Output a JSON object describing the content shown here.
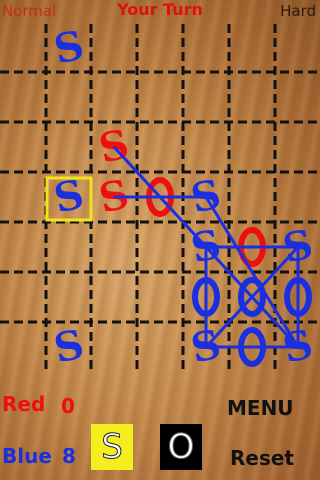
{
  "header": {
    "mode": "Normal",
    "turn": "Your Turn",
    "difficulty": "Hard"
  },
  "score": {
    "red_label": "Red",
    "red_value": "0",
    "blue_label": "Blue",
    "blue_value": "8"
  },
  "controls": {
    "menu_label": "MENU",
    "reset_label": "Reset",
    "s_label": "S",
    "o_label": "O"
  },
  "colors": {
    "red": "#ee1010",
    "blue": "#1a30e0",
    "selection": "#f2e21a",
    "s_button": "#f5ee1e",
    "o_button": "#000000"
  },
  "board": {
    "selected_cell": {
      "row": 3,
      "col": 1
    },
    "pieces": [
      {
        "row": 0,
        "col": 1,
        "letter": "S",
        "color": "blue"
      },
      {
        "row": 2,
        "col": 2,
        "letter": "S",
        "color": "red"
      },
      {
        "row": 3,
        "col": 1,
        "letter": "S",
        "color": "blue"
      },
      {
        "row": 3,
        "col": 2,
        "letter": "S",
        "color": "red"
      },
      {
        "row": 3,
        "col": 3,
        "letter": "O",
        "color": "red"
      },
      {
        "row": 3,
        "col": 4,
        "letter": "S",
        "color": "blue"
      },
      {
        "row": 4,
        "col": 4,
        "letter": "S",
        "color": "blue"
      },
      {
        "row": 4,
        "col": 5,
        "letter": "O",
        "color": "red"
      },
      {
        "row": 4,
        "col": 6,
        "letter": "S",
        "color": "blue"
      },
      {
        "row": 5,
        "col": 4,
        "letter": "O",
        "color": "blue"
      },
      {
        "row": 5,
        "col": 5,
        "letter": "O",
        "color": "blue"
      },
      {
        "row": 5,
        "col": 6,
        "letter": "O",
        "color": "blue"
      },
      {
        "row": 6,
        "col": 1,
        "letter": "S",
        "color": "blue"
      },
      {
        "row": 6,
        "col": 4,
        "letter": "S",
        "color": "blue"
      },
      {
        "row": 6,
        "col": 5,
        "letter": "O",
        "color": "blue"
      },
      {
        "row": 6,
        "col": 6,
        "letter": "S",
        "color": "blue"
      }
    ],
    "sos_lines": [
      {
        "from": [
          2,
          2
        ],
        "to": [
          4,
          4
        ]
      },
      {
        "from": [
          3,
          2
        ],
        "to": [
          3,
          4
        ]
      },
      {
        "from": [
          3,
          4
        ],
        "to": [
          6,
          6
        ]
      },
      {
        "from": [
          4,
          4
        ],
        "to": [
          4,
          6
        ]
      },
      {
        "from": [
          4,
          4
        ],
        "to": [
          6,
          4
        ]
      },
      {
        "from": [
          4,
          6
        ],
        "to": [
          6,
          6
        ]
      },
      {
        "from": [
          6,
          4
        ],
        "to": [
          6,
          6
        ]
      },
      {
        "from": [
          4,
          4
        ],
        "to": [
          6,
          6
        ]
      },
      {
        "from": [
          4,
          6
        ],
        "to": [
          6,
          4
        ]
      }
    ]
  }
}
